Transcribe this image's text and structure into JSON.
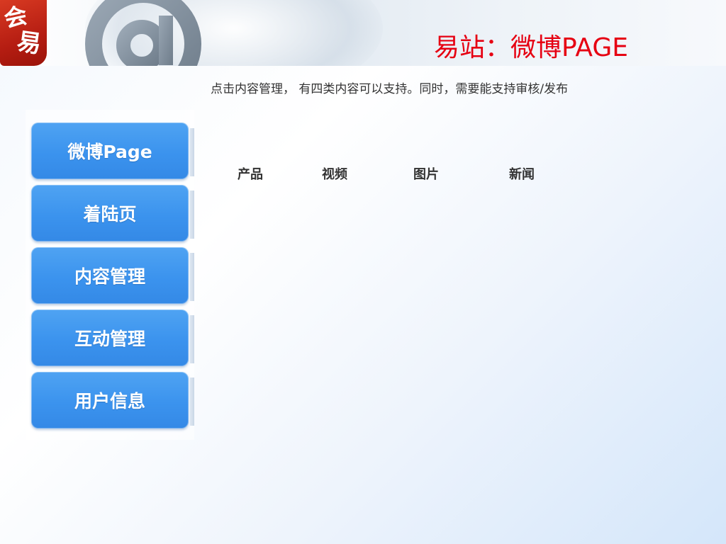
{
  "header": {
    "logo_chars": [
      "会",
      "易"
    ],
    "title": "易站：微博PAGE"
  },
  "description": "点击内容管理， 有四类内容可以支持。同时，需要能支持审核/发布",
  "sidebar": {
    "items": [
      {
        "label": "微博Page"
      },
      {
        "label": "着陆页"
      },
      {
        "label": "内容管理"
      },
      {
        "label": "互动管理"
      },
      {
        "label": "用户信息"
      }
    ]
  },
  "content_types": [
    {
      "label": "产品"
    },
    {
      "label": "视频"
    },
    {
      "label": "图片"
    },
    {
      "label": "新闻"
    }
  ],
  "colors": {
    "title_red": "#e60012",
    "button_blue": "#3b93ee",
    "logo_red": "#c8281a"
  }
}
